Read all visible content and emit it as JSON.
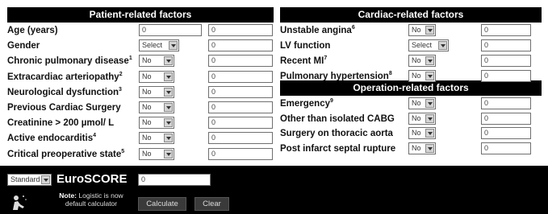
{
  "headers": {
    "patient": "Patient-related factors",
    "cardiac": "Cardiac-related factors",
    "operation": "Operation-related factors"
  },
  "patient_factors": [
    {
      "label": "Age (years)",
      "sup": "",
      "control": "input",
      "select_value": "",
      "input_value": "0",
      "score": "0"
    },
    {
      "label": "Gender",
      "sup": "",
      "control": "select",
      "select_value": "Select",
      "score": "0"
    },
    {
      "label": "Chronic pulmonary disease",
      "sup": "1",
      "control": "select",
      "select_value": "No",
      "score": "0"
    },
    {
      "label": "Extracardiac arteriopathy",
      "sup": "2",
      "control": "select",
      "select_value": "No",
      "score": "0"
    },
    {
      "label": "Neurological dysfunction",
      "sup": "3",
      "control": "select",
      "select_value": "No",
      "score": "0"
    },
    {
      "label": "Previous Cardiac Surgery",
      "sup": "",
      "control": "select",
      "select_value": "No",
      "score": "0"
    },
    {
      "label": "Creatinine > 200 µmol/ L",
      "sup": "",
      "control": "select",
      "select_value": "No",
      "score": "0"
    },
    {
      "label": "Active endocarditis",
      "sup": "4",
      "control": "select",
      "select_value": "No",
      "score": "0"
    },
    {
      "label": "Critical preoperative state",
      "sup": "5",
      "control": "select",
      "select_value": "No",
      "score": "0"
    }
  ],
  "cardiac_factors": [
    {
      "label": "Unstable angina",
      "sup": "6",
      "select_value": "No",
      "score": "0"
    },
    {
      "label": "LV function",
      "sup": "",
      "select_value": "Select",
      "score": "0"
    },
    {
      "label": "Recent MI",
      "sup": "7",
      "select_value": "No",
      "score": "0"
    },
    {
      "label": "Pulmonary hypertension",
      "sup": "8",
      "select_value": "No",
      "score": "0"
    }
  ],
  "operation_factors": [
    {
      "label": "Emergency",
      "sup": "9",
      "select_value": "No",
      "score": "0"
    },
    {
      "label": "Other than isolated CABG",
      "sup": "",
      "select_value": "No",
      "score": "0"
    },
    {
      "label": "Surgery on thoracic aorta",
      "sup": "",
      "select_value": "No",
      "score": "0"
    },
    {
      "label": "Post infarct septal rupture",
      "sup": "",
      "select_value": "No",
      "score": "0"
    }
  ],
  "footer": {
    "model_select": "Standard",
    "euro_prefix": "Euro",
    "euro_suffix": "SCORE",
    "euroscore_value": "0",
    "note_bold": "Note:",
    "note_text": "Logistic is now default calculator",
    "calculate_label": "Calculate",
    "clear_label": "Clear"
  }
}
